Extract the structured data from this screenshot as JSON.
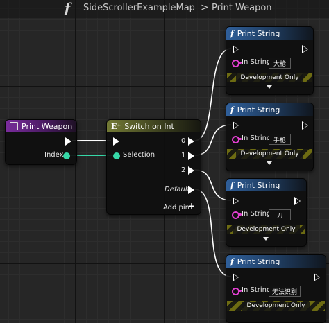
{
  "breadcrumb": {
    "function_icon": "function-icon",
    "map_name": "SideScrollerExampleMap",
    "separator": ">",
    "function_name": "Print Weapon"
  },
  "event_node": {
    "title": "Print Weapon",
    "icon": "event-icon",
    "output_label": "Index",
    "color": "#7b2c9e"
  },
  "switch_node": {
    "title": "Switch on Int",
    "icon": "switch-icon",
    "input_label": "Selection",
    "outputs": [
      "0",
      "1",
      "2",
      "Default"
    ],
    "add_pin_label": "Add pin",
    "color": "#737a35"
  },
  "print_nodes": [
    {
      "title": "Print String",
      "in_string_label": "In String",
      "value": "大枪",
      "dev_label": "Development Only"
    },
    {
      "title": "Print String",
      "in_string_label": "In String",
      "value": "手枪",
      "dev_label": "Development Only"
    },
    {
      "title": "Print String",
      "in_string_label": "In String",
      "value": "刀",
      "dev_label": "Development Only"
    },
    {
      "title": "Print String",
      "in_string_label": "In String",
      "value": "无法识别",
      "dev_label": "Development Only"
    }
  ],
  "colors": {
    "exec_pin": "#ffffff",
    "integer_pin": "#36d8a8",
    "string_pin": "#e23fd0",
    "print_header": "#2f5f9a",
    "dev_stripe": "#6d6b12"
  }
}
